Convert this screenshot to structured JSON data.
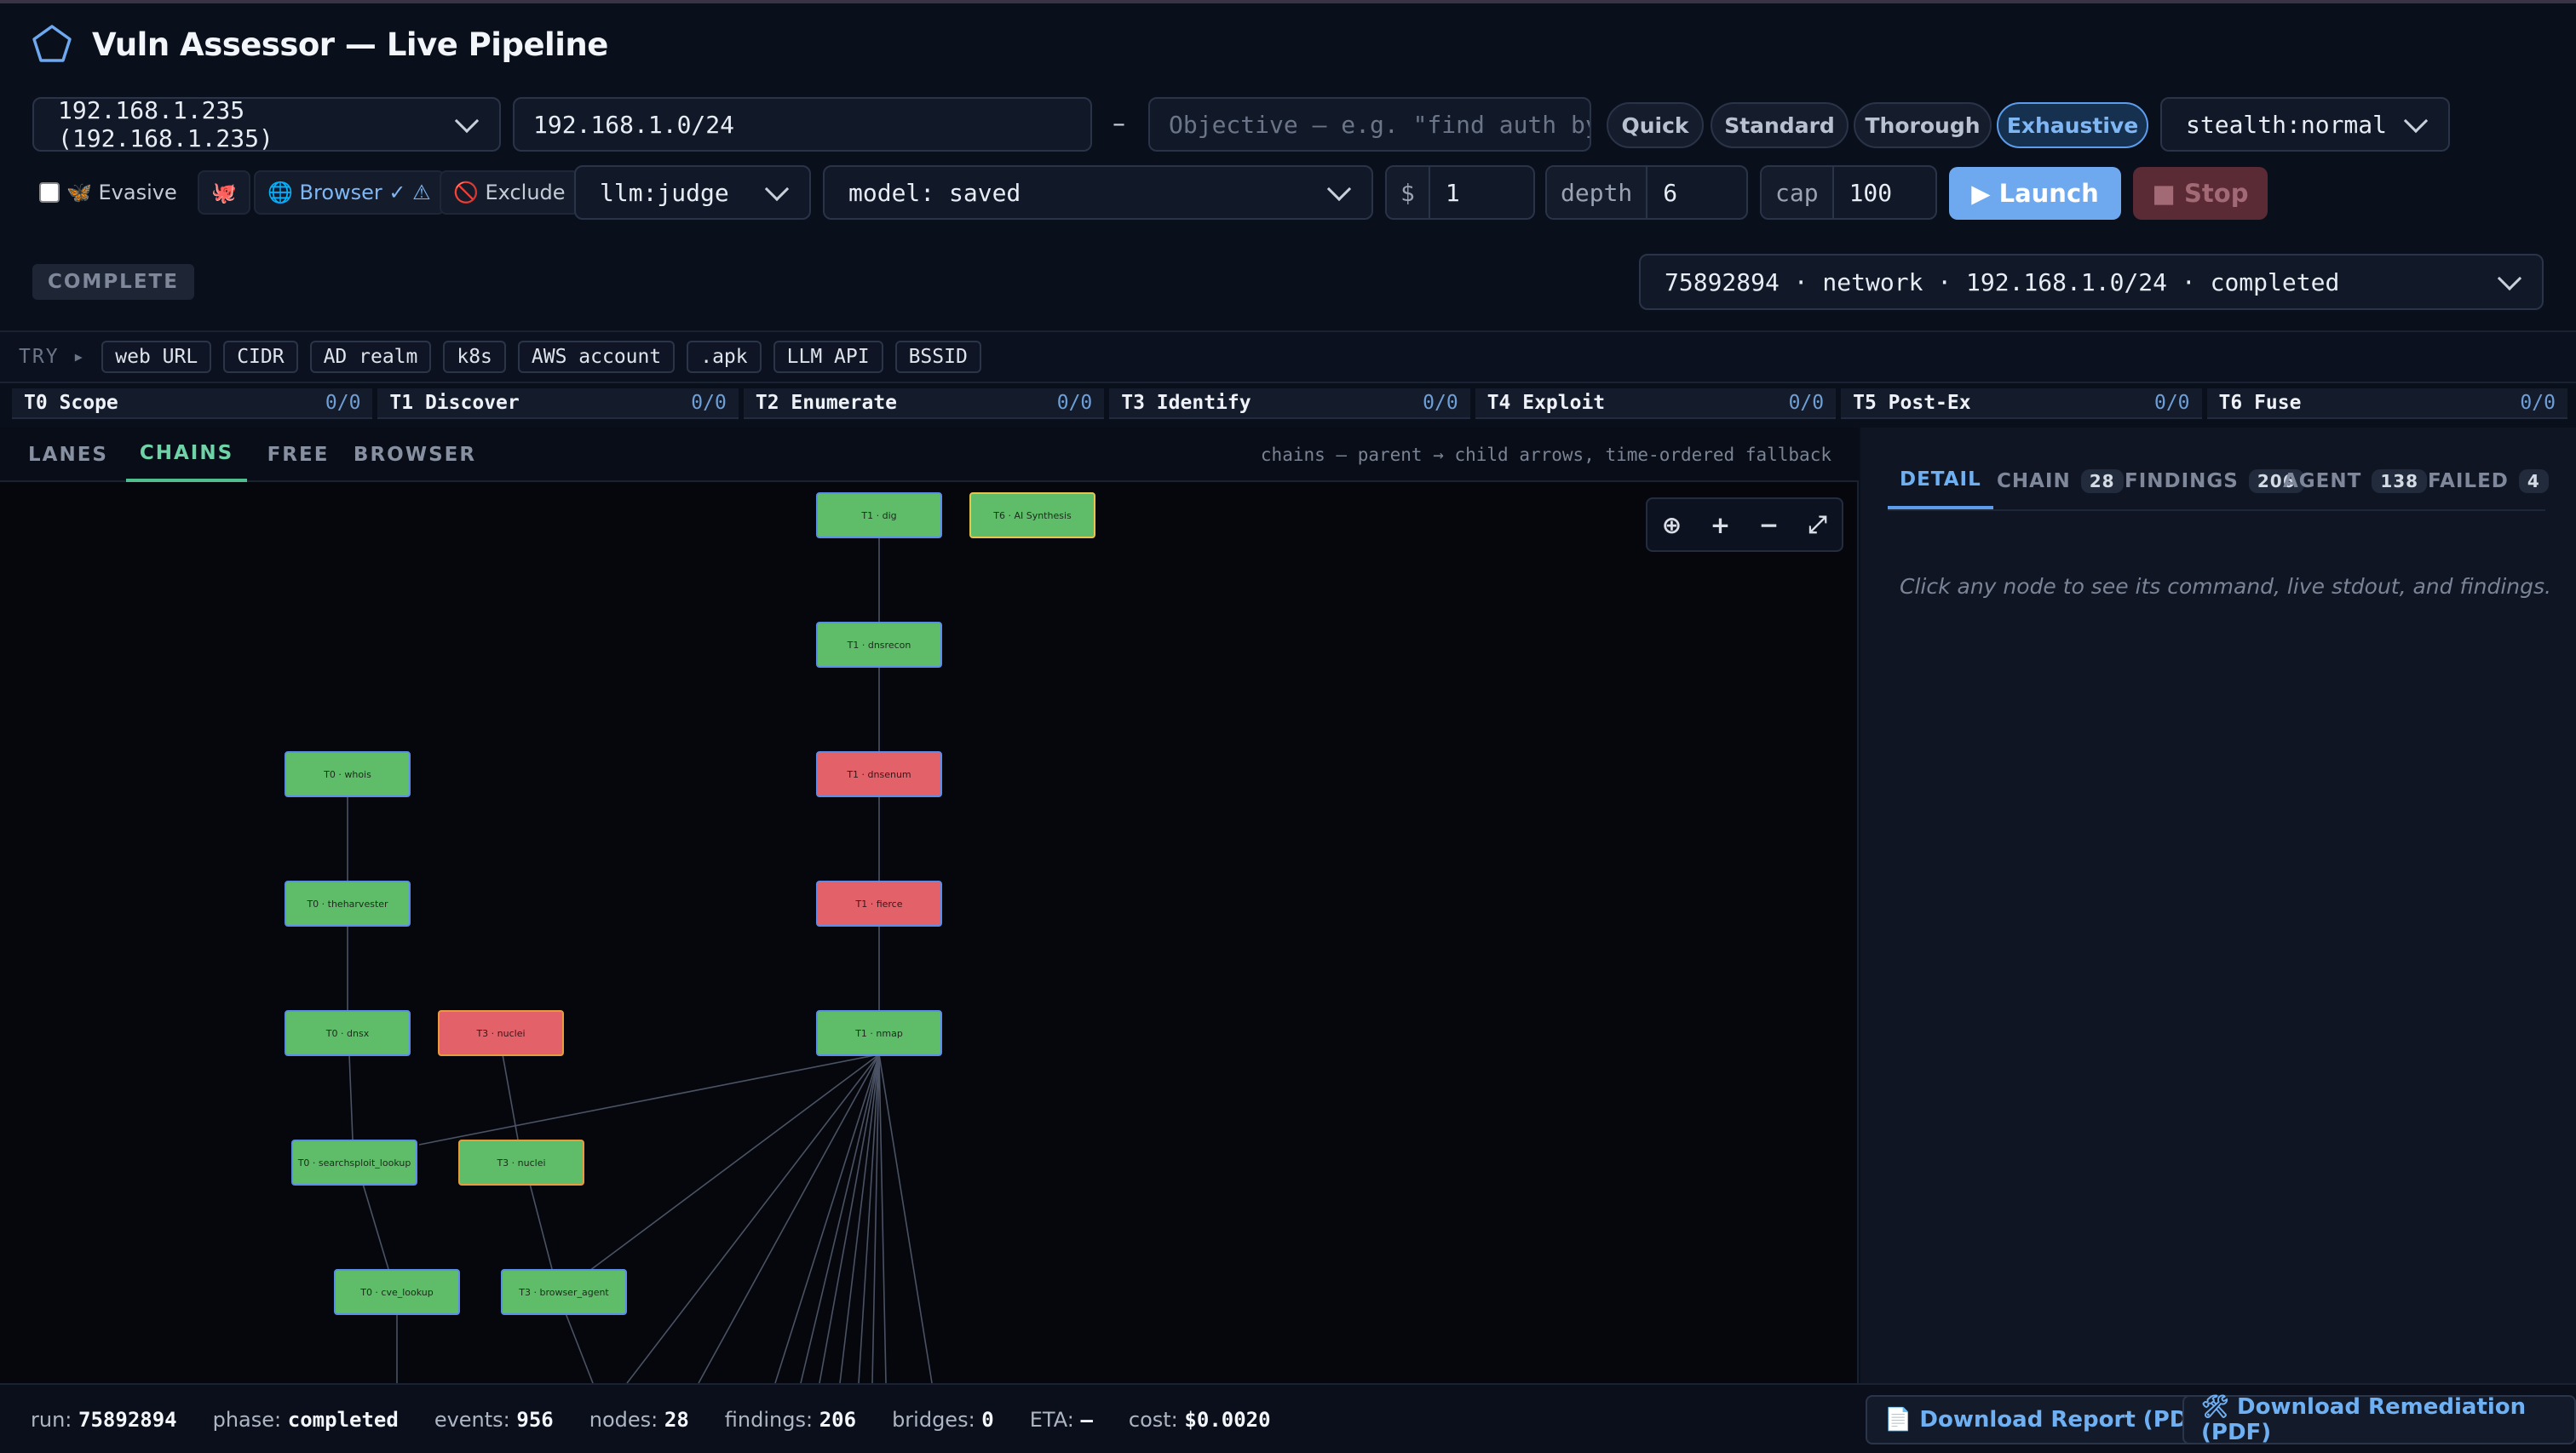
{
  "app": {
    "title": "Vuln Assessor — Live Pipeline",
    "logo_icon": "pentagon-icon"
  },
  "controls": {
    "host_select": "192.168.1.235 (192.168.1.235)",
    "target_value": "192.168.1.0/24",
    "dash": "–",
    "objective_placeholder": "Objective — e.g. \"find auth by",
    "modes": [
      "Quick",
      "Standard",
      "Thorough",
      "Exhaustive"
    ],
    "active_mode": "Exhaustive",
    "stealth_select": "stealth:normal",
    "evasive_label": "🦋 Evasive",
    "unicorn_icon": "🐙",
    "browser_label": "🌐 Browser ✓ ⚠",
    "exclude_label": "🚫 Exclude",
    "llm_select": "llm:judge",
    "model_select": "model: saved",
    "budget_label": "$",
    "budget_value": "1",
    "depth_label": "depth",
    "depth_value": "6",
    "cap_label": "cap",
    "cap_value": "100",
    "launch_label": "▶ Launch",
    "stop_label": "■ Stop"
  },
  "status": {
    "badge": "COMPLETE",
    "run_select": "75892894 · network · 192.168.1.0/24 · completed"
  },
  "try": {
    "label": "TRY ▸",
    "chips": [
      "web URL",
      "CIDR",
      "AD realm",
      "k8s",
      "AWS account",
      ".apk",
      "LLM API",
      "BSSID"
    ]
  },
  "tiers": [
    {
      "name": "T0 Scope",
      "count": "0/0"
    },
    {
      "name": "T1 Discover",
      "count": "0/0"
    },
    {
      "name": "T2 Enumerate",
      "count": "0/0"
    },
    {
      "name": "T3 Identify",
      "count": "0/0"
    },
    {
      "name": "T4 Exploit",
      "count": "0/0"
    },
    {
      "name": "T5 Post-Ex",
      "count": "0/0"
    },
    {
      "name": "T6 Fuse",
      "count": "0/0"
    }
  ],
  "graph": {
    "tabs": [
      "LANES",
      "CHAINS",
      "FREE",
      "BROWSER"
    ],
    "active_tab": "CHAINS",
    "hint": "chains — parent → child arrows, time-ordered fallback",
    "zoom_buttons": [
      "⊕",
      "+",
      "−",
      "⤢"
    ],
    "nodes": [
      {
        "label": "T1 · dig",
        "status": "success"
      },
      {
        "label": "T6 · AI Synthesis",
        "status": "success"
      },
      {
        "label": "T1 · dnsrecon",
        "status": "success"
      },
      {
        "label": "T0 · whois",
        "status": "success"
      },
      {
        "label": "T1 · dnsenum",
        "status": "failed"
      },
      {
        "label": "T0 · theharvester",
        "status": "success"
      },
      {
        "label": "T1 · fierce",
        "status": "failed"
      },
      {
        "label": "T0 · dnsx",
        "status": "success"
      },
      {
        "label": "T3 · nuclei",
        "status": "failed"
      },
      {
        "label": "T1 · nmap",
        "status": "success"
      },
      {
        "label": "T0 · searchsploit_lookup",
        "status": "success"
      },
      {
        "label": "T3 · nuclei",
        "status": "success"
      },
      {
        "label": "T0 · cve_lookup",
        "status": "success"
      },
      {
        "label": "T3 · browser_agent",
        "status": "success"
      }
    ]
  },
  "detail": {
    "tabs": [
      {
        "label": "DETAIL",
        "count": ""
      },
      {
        "label": "CHAIN",
        "count": "28"
      },
      {
        "label": "FINDINGS",
        "count": "206"
      },
      {
        "label": "AGENT",
        "count": "138"
      },
      {
        "label": "FAILED",
        "count": "4"
      }
    ],
    "active_tab": "DETAIL",
    "hint": "Click any node to see its command, live stdout, and findings."
  },
  "footer": {
    "run_label": "run:",
    "run": "75892894",
    "phase_label": "phase:",
    "phase": "completed",
    "events_label": "events:",
    "events": "956",
    "nodes_label": "nodes:",
    "nodes": "28",
    "findings_label": "findings:",
    "findings": "206",
    "bridges_label": "bridges:",
    "bridges": "0",
    "eta_label": "ETA:",
    "eta": "—",
    "cost_label": "cost:",
    "cost": "$0.0020",
    "report_button": "📄 Download Report (PDF)",
    "remediation_button": "🛠 Download Remediation (PDF)"
  },
  "colors": {
    "background": "#0a0f1c",
    "accent": "#6ea8ef",
    "success_node": "#5fbd6a",
    "failed_node": "#e3626a",
    "chains_tab": "#6fd3a7"
  }
}
